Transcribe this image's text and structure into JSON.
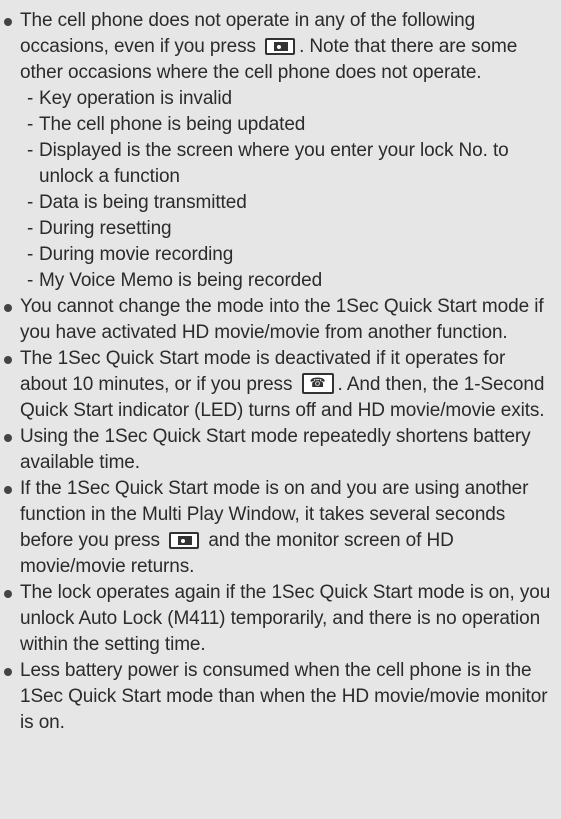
{
  "bullets": [
    {
      "text_before": "The cell phone does not operate in any of the following occasions, even if you press",
      "icon": "camera-key-icon",
      "text_after": ". Note that there are some other occasions where the cell phone does not operate.",
      "subitems": [
        "Key operation is invalid",
        "The cell phone is being updated",
        "Displayed is the screen where you enter your lock No. to unlock a function",
        "Data is being transmitted",
        "During resetting",
        "During movie recording",
        "My Voice Memo is being recorded"
      ]
    },
    {
      "text": "You cannot change the mode into the 1Sec Quick Start mode if you have activated HD movie/movie from another function."
    },
    {
      "text_before": "The 1Sec Quick Start mode is deactivated if it operates for about 10 minutes, or if you press",
      "icon": "power-key-icon",
      "text_after": ". And then, the 1-Second Quick Start indicator (LED) turns off and HD movie/movie exits."
    },
    {
      "text": "Using the 1Sec Quick Start mode repeatedly shortens battery available time."
    },
    {
      "text_before": "If the 1Sec Quick Start mode is on and you are using another function in the Multi Play Window, it takes several seconds before you press",
      "icon": "camera-key-icon",
      "text_after": "and the monitor screen of HD movie/movie returns."
    },
    {
      "text": "The lock operates again if the 1Sec Quick Start mode is on, you unlock Auto Lock (M411) temporarily, and there is no operation within the setting time."
    },
    {
      "text": "Less battery power is consumed when the cell phone is in the 1Sec Quick Start mode than when the HD movie/movie monitor is on."
    }
  ]
}
